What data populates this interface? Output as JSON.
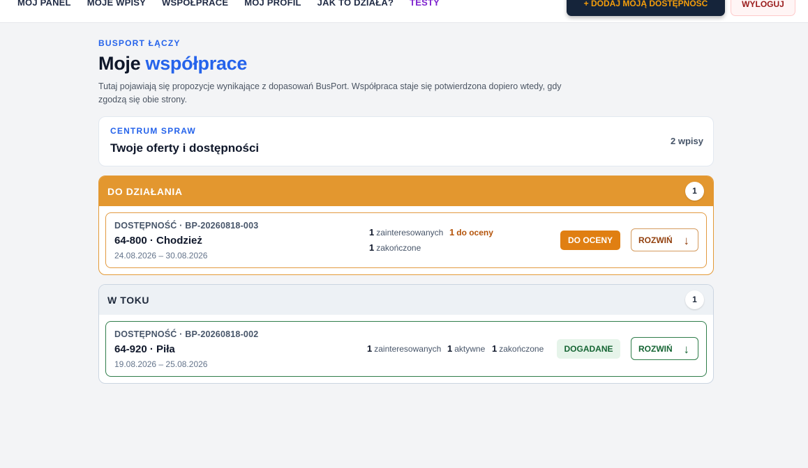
{
  "nav": {
    "items": [
      "MÓJ PANEL",
      "MOJE WPISY",
      "WSPÓŁPRACE",
      "MÓJ PROFIL",
      "JAK TO DZIAŁA?",
      "TESTY"
    ],
    "add_button": "+ DODAJ MOJĄ DOSTĘPNOŚĆ",
    "logout_button": "WYLOGUJ"
  },
  "header": {
    "eyebrow": "BUSPORT ŁĄCZY",
    "title_plain": "Moje",
    "title_accent": "współprace",
    "description": "Tutaj pojawiają się propozycje wynikające z dopasowań BusPort. Współpraca staje się potwierdzona dopiero wtedy, gdy zgodzą się obie strony."
  },
  "summary": {
    "kicker": "CENTRUM SPRAW",
    "heading": "Twoje oferty i dostępności",
    "count": "2 wpisy"
  },
  "sections": [
    {
      "label": "DO DZIAŁANIA",
      "count": "1",
      "item": {
        "ref": "DOSTĘPNOŚĆ · BP-20260818-003",
        "place": "64-800 · Chodzież",
        "dates": "24.08.2026 – 30.08.2026",
        "stats": [
          {
            "num": "1",
            "label": "zainteresowanych"
          },
          {
            "num": "1",
            "label": "do oceny"
          },
          {
            "num": "1",
            "label": "zakończone"
          }
        ],
        "badge": "DO OCENY",
        "expand": "ROZWIŃ",
        "arrow": "↓"
      }
    },
    {
      "label": "W TOKU",
      "count": "1",
      "item": {
        "ref": "DOSTĘPNOŚĆ · BP-20260818-002",
        "place": "64-920 · Piła",
        "dates": "19.08.2026 – 25.08.2026",
        "stats": [
          {
            "num": "1",
            "label": "zainteresowanych"
          },
          {
            "num": "1",
            "label": "aktywne"
          },
          {
            "num": "1",
            "label": "zakończone"
          }
        ],
        "badge": "DOGADANE",
        "expand": "ROZWIŃ",
        "arrow": "↓"
      }
    }
  ],
  "colors": {
    "accent": "#2563eb",
    "action_orange": "#e3972f",
    "navy": "#15243a",
    "success_green": "#166534"
  }
}
